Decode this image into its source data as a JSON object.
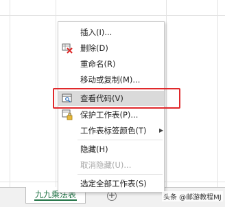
{
  "sheet_tab": {
    "label": "九九乘法表"
  },
  "add_sheet": {
    "symbol": "+"
  },
  "context_menu": {
    "items": [
      {
        "label": "插入(I)...",
        "icon": "none",
        "disabled": false
      },
      {
        "label": "删除(D)",
        "icon": "delete-sheet-icon",
        "disabled": false
      },
      {
        "label": "重命名(R)",
        "icon": "none",
        "disabled": false
      },
      {
        "label": "移动或复制(M)...",
        "icon": "none",
        "disabled": false
      },
      {
        "label": "查看代码(V)",
        "icon": "view-code-icon",
        "disabled": false,
        "highlighted": true
      },
      {
        "label": "保护工作表(P)...",
        "icon": "protect-sheet-icon",
        "disabled": false
      },
      {
        "label": "工作表标签颜色(T)",
        "icon": "none",
        "disabled": false,
        "submenu": true
      },
      {
        "label": "隐藏(H)",
        "icon": "none",
        "disabled": false
      },
      {
        "label": "取消隐藏(U)...",
        "icon": "none",
        "disabled": true
      },
      {
        "label": "选定全部工作表(S)",
        "icon": "none",
        "disabled": false
      }
    ]
  },
  "watermark": {
    "text": "头条 @邮游教程MJ"
  },
  "colors": {
    "highlight": "#dadada",
    "annotation": "#e0282b",
    "tab_accent": "#217346"
  }
}
